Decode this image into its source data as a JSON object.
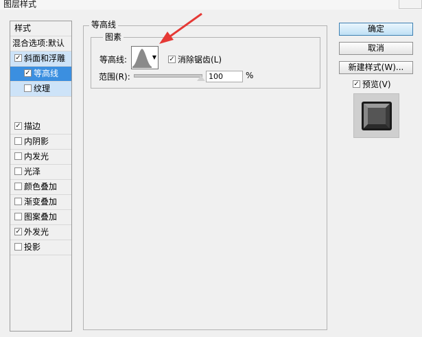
{
  "window": {
    "title": "图层样式"
  },
  "sidebar": {
    "header": "样式",
    "blend_options": "混合选项:默认",
    "items": [
      {
        "label": "斜面和浮雕",
        "checked": true
      },
      {
        "label": "等高线",
        "checked": true
      },
      {
        "label": "纹理",
        "checked": false
      },
      {
        "label": "描边",
        "checked": true
      },
      {
        "label": "内阴影",
        "checked": false
      },
      {
        "label": "内发光",
        "checked": false
      },
      {
        "label": "光泽",
        "checked": false
      },
      {
        "label": "颜色叠加",
        "checked": false
      },
      {
        "label": "渐变叠加",
        "checked": false
      },
      {
        "label": "图案叠加",
        "checked": false
      },
      {
        "label": "外发光",
        "checked": true
      },
      {
        "label": "投影",
        "checked": false
      }
    ]
  },
  "main": {
    "group_title": "等高线",
    "subgroup_title": "图素",
    "contour_label": "等高线:",
    "antialias_label": "消除锯齿(L)",
    "antialias_checked": true,
    "range_label": "范围(R):",
    "range_value": "100",
    "range_unit": "%"
  },
  "buttons": {
    "ok": "确定",
    "cancel": "取消",
    "new_style": "新建样式(W)...",
    "preview_label": "预览(V)",
    "preview_checked": true
  },
  "colors": {
    "selected_dark": "#3b8fe0",
    "selected_light": "#cde3f8",
    "arrow": "#e53935"
  }
}
